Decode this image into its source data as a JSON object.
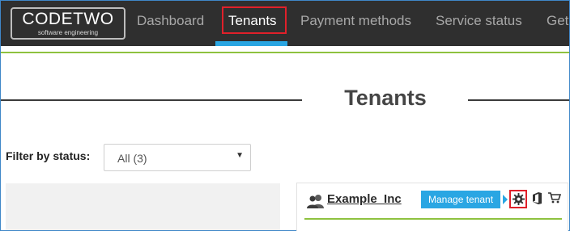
{
  "logo": {
    "main": "CODETWO",
    "sub": "software engineering"
  },
  "nav": {
    "items": [
      {
        "label": "Dashboard",
        "active": false
      },
      {
        "label": "Tenants",
        "active": true
      },
      {
        "label": "Payment methods",
        "active": false
      },
      {
        "label": "Service status",
        "active": false
      },
      {
        "label": "Get",
        "active": false
      }
    ]
  },
  "page": {
    "title": "Tenants"
  },
  "filter": {
    "label": "Filter by status:",
    "selected": "All (3)"
  },
  "tenant": {
    "name": "Example_Inc",
    "tooltip": "Manage tenant",
    "icons": [
      "user-group-icon",
      "gear-icon",
      "office-icon",
      "cart-icon"
    ]
  },
  "colors": {
    "nav_bg": "#2f2f2f",
    "accent_blue": "#2aa6e3",
    "accent_green": "#8ec23f",
    "highlight_red": "#e0202a"
  }
}
